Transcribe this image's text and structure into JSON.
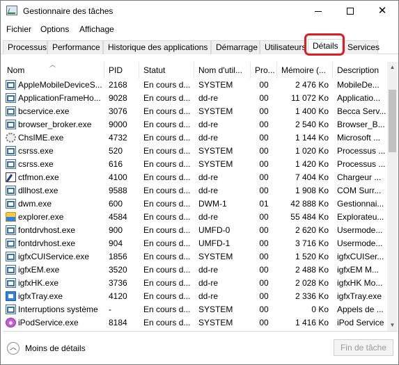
{
  "window": {
    "title": "Gestionnaire des tâches"
  },
  "menu": [
    "Fichier",
    "Options",
    "Affichage"
  ],
  "tabs": [
    "Processus",
    "Performance",
    "Historique des applications",
    "Démarrage",
    "Utilisateurs",
    "Détails",
    "Services"
  ],
  "active_tab": "Détails",
  "highlight_color": "#e11b22",
  "columns": [
    "Nom",
    "PID",
    "Statut",
    "Nom d'util...",
    "Pro...",
    "Mémoire (...",
    "Description"
  ],
  "rows": [
    {
      "name": "AppleMobileDeviceS...",
      "pid": "2168",
      "status": "En cours d...",
      "user": "SYSTEM",
      "cpu": "00",
      "mem": "2 476 Ko",
      "desc": "MobileDe...",
      "icon": "window-icon"
    },
    {
      "name": "ApplicationFrameHo...",
      "pid": "9028",
      "status": "En cours d...",
      "user": "dd-re",
      "cpu": "00",
      "mem": "11 072 Ko",
      "desc": "Applicatio...",
      "icon": "window-icon"
    },
    {
      "name": "bcservice.exe",
      "pid": "3076",
      "status": "En cours d...",
      "user": "SYSTEM",
      "cpu": "00",
      "mem": "1 400 Ko",
      "desc": "Becca Serv...",
      "icon": "window-icon"
    },
    {
      "name": "browser_broker.exe",
      "pid": "9000",
      "status": "En cours d...",
      "user": "dd-re",
      "cpu": "00",
      "mem": "2 540 Ko",
      "desc": "Browser_B...",
      "icon": "window-icon"
    },
    {
      "name": "ChsIME.exe",
      "pid": "4732",
      "status": "En cours d...",
      "user": "dd-re",
      "cpu": "00",
      "mem": "1 144 Ko",
      "desc": "Microsoft ...",
      "icon": "gear-icon"
    },
    {
      "name": "csrss.exe",
      "pid": "520",
      "status": "En cours d...",
      "user": "SYSTEM",
      "cpu": "00",
      "mem": "1 020 Ko",
      "desc": "Processus ...",
      "icon": "window-icon"
    },
    {
      "name": "csrss.exe",
      "pid": "616",
      "status": "En cours d...",
      "user": "SYSTEM",
      "cpu": "00",
      "mem": "1 420 Ko",
      "desc": "Processus ...",
      "icon": "window-icon"
    },
    {
      "name": "ctfmon.exe",
      "pid": "4100",
      "status": "En cours d...",
      "user": "dd-re",
      "cpu": "00",
      "mem": "7 404 Ko",
      "desc": "Chargeur ...",
      "icon": "pen-icon"
    },
    {
      "name": "dllhost.exe",
      "pid": "9588",
      "status": "En cours d...",
      "user": "dd-re",
      "cpu": "00",
      "mem": "1 908 Ko",
      "desc": "COM Surr...",
      "icon": "window-icon"
    },
    {
      "name": "dwm.exe",
      "pid": "600",
      "status": "En cours d...",
      "user": "DWM-1",
      "cpu": "01",
      "mem": "42 888 Ko",
      "desc": "Gestionnai...",
      "icon": "window-icon"
    },
    {
      "name": "explorer.exe",
      "pid": "4584",
      "status": "En cours d...",
      "user": "dd-re",
      "cpu": "00",
      "mem": "55 484 Ko",
      "desc": "Explorateu...",
      "icon": "folder-icon"
    },
    {
      "name": "fontdrvhost.exe",
      "pid": "900",
      "status": "En cours d...",
      "user": "UMFD-0",
      "cpu": "00",
      "mem": "2 620 Ko",
      "desc": "Usermode...",
      "icon": "window-icon"
    },
    {
      "name": "fontdrvhost.exe",
      "pid": "904",
      "status": "En cours d...",
      "user": "UMFD-1",
      "cpu": "00",
      "mem": "3 716 Ko",
      "desc": "Usermode...",
      "icon": "window-icon"
    },
    {
      "name": "igfxCUIService.exe",
      "pid": "1856",
      "status": "En cours d...",
      "user": "SYSTEM",
      "cpu": "00",
      "mem": "1 520 Ko",
      "desc": "igfxCUISer...",
      "icon": "window-icon"
    },
    {
      "name": "igfxEM.exe",
      "pid": "3520",
      "status": "En cours d...",
      "user": "dd-re",
      "cpu": "00",
      "mem": "2 488 Ko",
      "desc": "igfxEM M...",
      "icon": "window-icon"
    },
    {
      "name": "igfxHK.exe",
      "pid": "3736",
      "status": "En cours d...",
      "user": "dd-re",
      "cpu": "00",
      "mem": "2 028 Ko",
      "desc": "igfxHK Mo...",
      "icon": "window-icon"
    },
    {
      "name": "igfxTray.exe",
      "pid": "4120",
      "status": "En cours d...",
      "user": "dd-re",
      "cpu": "00",
      "mem": "2 336 Ko",
      "desc": "igfxTray.exe",
      "icon": "tray-icon"
    },
    {
      "name": "Interruptions système",
      "pid": "-",
      "status": "En cours d...",
      "user": "SYSTEM",
      "cpu": "00",
      "mem": "0 Ko",
      "desc": "Appels de ...",
      "icon": "window-icon"
    },
    {
      "name": "iPodService.exe",
      "pid": "8184",
      "status": "En cours d...",
      "user": "SYSTEM",
      "cpu": "00",
      "mem": "1 416 Ko",
      "desc": "iPod Service",
      "icon": "ipod-icon"
    }
  ],
  "footer": {
    "less_details": "Moins de détails",
    "end_task": "Fin de tâche"
  }
}
